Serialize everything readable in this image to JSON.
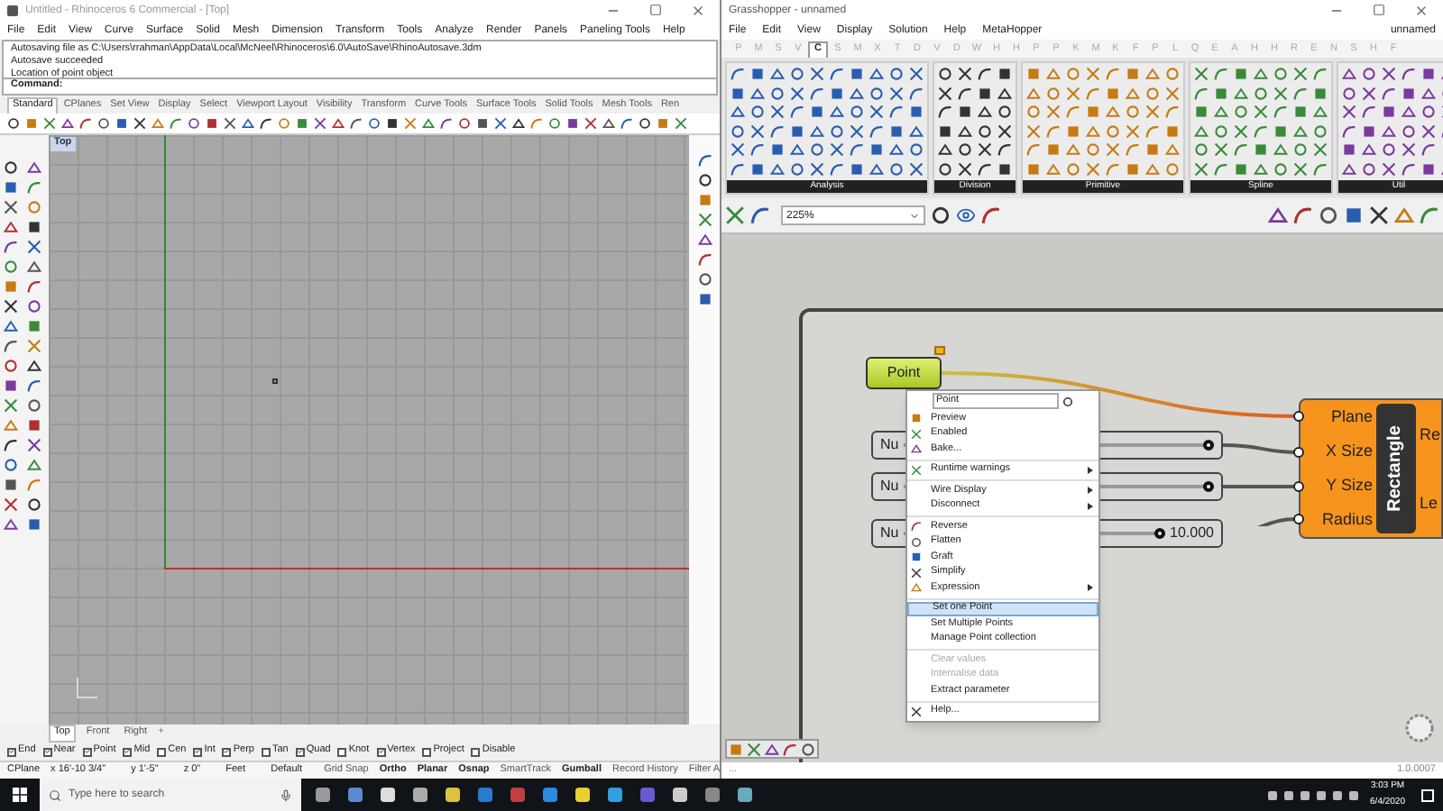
{
  "rhino": {
    "title": "Untitled - Rhinoceros 6 Commercial - [Top]",
    "menu": [
      "File",
      "Edit",
      "View",
      "Curve",
      "Surface",
      "Solid",
      "Mesh",
      "Dimension",
      "Transform",
      "Tools",
      "Analyze",
      "Render",
      "Panels",
      "Paneling Tools",
      "Help"
    ],
    "command_history": [
      "Autosaving file as C:\\Users\\rrahman\\AppData\\Local\\McNeel\\Rhinoceros\\6.0\\AutoSave\\RhinoAutosave.3dm",
      "Autosave succeeded",
      "Location of point object"
    ],
    "command_prompt": "Command:",
    "toolbar_tabs": [
      {
        "label": "Standard",
        "selected": true
      },
      {
        "label": "CPlanes",
        "selected": false
      },
      {
        "label": "Set View",
        "selected": false
      },
      {
        "label": "Display",
        "selected": false
      },
      {
        "label": "Select",
        "selected": false
      },
      {
        "label": "Viewport Layout",
        "selected": false
      },
      {
        "label": "Visibility",
        "selected": false
      },
      {
        "label": "Transform",
        "selected": false
      },
      {
        "label": "Curve Tools",
        "selected": false
      },
      {
        "label": "Surface Tools",
        "selected": false
      },
      {
        "label": "Solid Tools",
        "selected": false
      },
      {
        "label": "Mesh Tools",
        "selected": false
      },
      {
        "label": "Ren",
        "selected": false
      }
    ],
    "viewport": {
      "label": "Top"
    },
    "viewport_tabs": [
      {
        "label": "Top",
        "selected": true
      },
      {
        "label": "Front",
        "selected": false
      },
      {
        "label": "Right",
        "selected": false
      }
    ],
    "add_tab": "+",
    "osnaps": [
      {
        "label": "End",
        "checked": true
      },
      {
        "label": "Near",
        "checked": true
      },
      {
        "label": "Point",
        "checked": true
      },
      {
        "label": "Mid",
        "checked": true
      },
      {
        "label": "Cen",
        "checked": false
      },
      {
        "label": "Int",
        "checked": true
      },
      {
        "label": "Perp",
        "checked": true
      },
      {
        "label": "Tan",
        "checked": false
      },
      {
        "label": "Quad",
        "checked": true
      },
      {
        "label": "Knot",
        "checked": false
      },
      {
        "label": "Vertex",
        "checked": true
      },
      {
        "label": "Project",
        "checked": false
      },
      {
        "label": "Disable",
        "checked": false
      }
    ],
    "status_bar": {
      "cplane": "CPlane",
      "x": "x 16'-10 3/4\"",
      "y": "y 1'-5\"",
      "z": "z 0\"",
      "units": "Feet",
      "layer": "Default",
      "toggles": [
        {
          "label": "Grid Snap",
          "on": false
        },
        {
          "label": "Ortho",
          "on": true
        },
        {
          "label": "Planar",
          "on": true
        },
        {
          "label": "Osnap",
          "on": true
        },
        {
          "label": "SmartTrack",
          "on": false
        },
        {
          "label": "Gumball",
          "on": true
        },
        {
          "label": "Record History",
          "on": false
        },
        {
          "label": "Filter A",
          "on": false
        }
      ]
    }
  },
  "grasshopper": {
    "title": "Grasshopper - unnamed",
    "menu": [
      "File",
      "Edit",
      "View",
      "Display",
      "Solution",
      "Help",
      "MetaHopper"
    ],
    "document_name": "unnamed",
    "tabs": [
      {
        "label": "P",
        "selected": false
      },
      {
        "label": "M",
        "selected": false
      },
      {
        "label": "S",
        "selected": false
      },
      {
        "label": "V",
        "selected": false
      },
      {
        "label": "C",
        "selected": true
      },
      {
        "label": "S",
        "selected": false
      },
      {
        "label": "M",
        "selected": false
      },
      {
        "label": "X",
        "selected": false
      },
      {
        "label": "T",
        "selected": false
      },
      {
        "label": "D",
        "selected": false
      },
      {
        "label": "V",
        "selected": false
      },
      {
        "label": "D",
        "selected": false
      },
      {
        "label": "W",
        "selected": false
      },
      {
        "label": "H",
        "selected": false
      },
      {
        "label": "H",
        "selected": false
      },
      {
        "label": "P",
        "selected": false
      },
      {
        "label": "P",
        "selected": false
      },
      {
        "label": "K",
        "selected": false
      },
      {
        "label": "M",
        "selected": false
      },
      {
        "label": "K",
        "selected": false
      },
      {
        "label": "F",
        "selected": false
      },
      {
        "label": "P",
        "selected": false
      },
      {
        "label": "L",
        "selected": false
      },
      {
        "label": "Q",
        "selected": false
      },
      {
        "label": "E",
        "selected": false
      },
      {
        "label": "A",
        "selected": false
      },
      {
        "label": "H",
        "selected": false
      },
      {
        "label": "H",
        "selected": false
      },
      {
        "label": "R",
        "selected": false
      },
      {
        "label": "E",
        "selected": false
      },
      {
        "label": "N",
        "selected": false
      },
      {
        "label": "S",
        "selected": false
      },
      {
        "label": "H",
        "selected": false
      },
      {
        "label": "F",
        "selected": false
      }
    ],
    "panel_groups": [
      "Analysis",
      "Division",
      "Primitive",
      "Spline",
      "Util"
    ],
    "zoom": "225%",
    "canvas": {
      "point_param": "Point",
      "sliders": [
        {
          "label": "Nu",
          "level": 1
        },
        {
          "label": "Nu",
          "level": 1
        },
        {
          "label": "Nu",
          "value": "10.000",
          "level": 1
        }
      ],
      "component": {
        "name": "Rectangle",
        "inputs": [
          "Plane",
          "X Size",
          "Y Size",
          "Radius"
        ],
        "outputs": [
          "Re",
          "Le"
        ]
      }
    },
    "context_menu": {
      "name_field": "Point",
      "groups": [
        [
          {
            "label": "Preview",
            "icon": true,
            "submenu": false,
            "selected": false,
            "disabled": false
          },
          {
            "label": "Enabled",
            "icon": true,
            "submenu": false,
            "selected": false,
            "disabled": false
          },
          {
            "label": "Bake...",
            "icon": true,
            "submenu": false,
            "selected": false,
            "disabled": false
          }
        ],
        [
          {
            "label": "Runtime warnings",
            "icon": true,
            "submenu": true,
            "selected": false,
            "disabled": false
          }
        ],
        [
          {
            "label": "Wire Display",
            "icon": false,
            "submenu": true,
            "selected": false,
            "disabled": false
          },
          {
            "label": "Disconnect",
            "icon": false,
            "submenu": true,
            "selected": false,
            "disabled": false
          }
        ],
        [
          {
            "label": "Reverse",
            "icon": true,
            "submenu": false,
            "selected": false,
            "disabled": false
          },
          {
            "label": "Flatten",
            "icon": true,
            "submenu": false,
            "selected": false,
            "disabled": false
          },
          {
            "label": "Graft",
            "icon": true,
            "submenu": false,
            "selected": false,
            "disabled": false
          },
          {
            "label": "Simplify",
            "icon": true,
            "submenu": false,
            "selected": false,
            "disabled": false
          },
          {
            "label": "Expression",
            "icon": true,
            "submenu": true,
            "selected": false,
            "disabled": false
          }
        ],
        [
          {
            "label": "Set one Point",
            "icon": false,
            "submenu": false,
            "selected": true,
            "disabled": false
          },
          {
            "label": "Set Multiple Points",
            "icon": false,
            "submenu": false,
            "selected": false,
            "disabled": false
          },
          {
            "label": "Manage Point collection",
            "icon": false,
            "submenu": false,
            "selected": false,
            "disabled": false
          }
        ],
        [
          {
            "label": "Clear values",
            "icon": false,
            "submenu": false,
            "selected": false,
            "disabled": true
          },
          {
            "label": "Internalise data",
            "icon": false,
            "submenu": false,
            "selected": false,
            "disabled": true
          },
          {
            "label": "Extract parameter",
            "icon": false,
            "submenu": false,
            "selected": false,
            "disabled": false
          }
        ],
        [
          {
            "label": "Help...",
            "icon": true,
            "submenu": false,
            "selected": false,
            "disabled": false
          }
        ]
      ]
    },
    "status_left": "...",
    "version": "1.0.0007"
  },
  "taskbar": {
    "search_placeholder": "Type here to search",
    "time": "3:03 PM",
    "date": "6/4/2020"
  }
}
